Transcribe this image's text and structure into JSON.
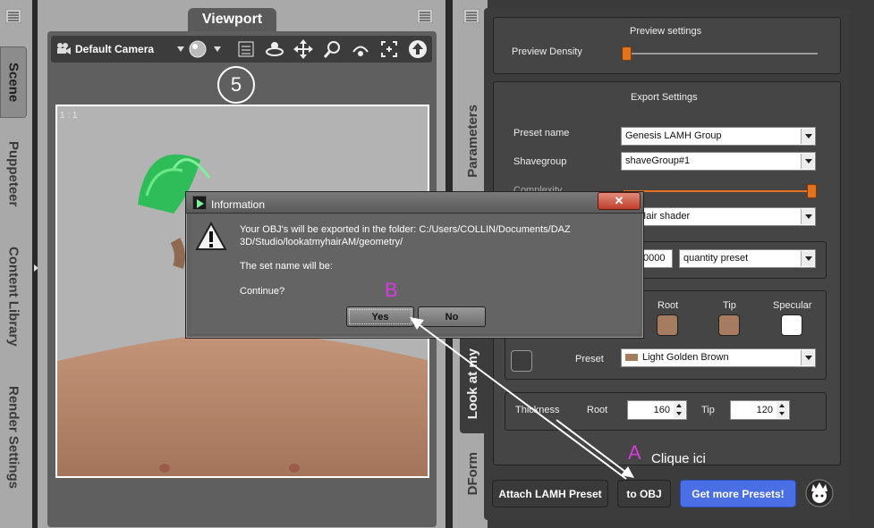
{
  "left_tabs": {
    "scene": "Scene",
    "puppeteer": "Puppeteer",
    "content_library": "Content Library",
    "render_settings": "Render Settings"
  },
  "viewport": {
    "tab_title": "Viewport",
    "camera": "Default Camera",
    "marker": "5",
    "ratio_label": "1 : 1"
  },
  "right_tabs": {
    "parameters": "Parameters",
    "look": "Look at my",
    "dform": "DForm"
  },
  "preview": {
    "title": "Preview settings",
    "density_label": "Preview Density",
    "density_value": 0.0
  },
  "export": {
    "title": "Export Settings",
    "preset_name_label": "Preset name",
    "preset_name_value": "Genesis LAMH Group",
    "shavegroup_label": "Shavegroup",
    "shavegroup_value": "shaveGroup#1",
    "complexity_label": "Complexity",
    "complexity_value": 1.0,
    "shader_value": "an Hair shader",
    "quantity_value": "0000",
    "quantity_preset": "quantity preset"
  },
  "color": {
    "root_label": "Root",
    "tip_label": "Tip",
    "specular_label": "Specular",
    "root_color": "#a57c60",
    "tip_color": "#a57c60",
    "specular_color": "#ffffff",
    "preset_label": "Preset",
    "preset_value": "Light Golden Brown",
    "preset_swatch": "#a57c60"
  },
  "thickness": {
    "label": "Thickness",
    "root_label": "Root",
    "root_value": "160",
    "tip_label": "Tip",
    "tip_value": "120"
  },
  "buttons": {
    "attach": "Attach LAMH Preset",
    "to_obj": "to OBJ",
    "more_presets": "Get more Presets!"
  },
  "dialog": {
    "title": "Information",
    "close": "✕",
    "message": "Your OBJ's will be exported in the folder: C:/Users/COLLIN/Documents/DAZ 3D/Studio/lookatmyhairAM/geometry/",
    "set_name": "The set name will be:",
    "continue": "Continue?",
    "yes": "Yes",
    "no": "No"
  },
  "annotations": {
    "a_letter": "A",
    "a_text": "Clique ici",
    "b_letter": "B"
  },
  "colors": {
    "accent_orange": "#e4721c",
    "button_blue": "#4a6fe5",
    "annotation_magenta": "#d63adf"
  }
}
